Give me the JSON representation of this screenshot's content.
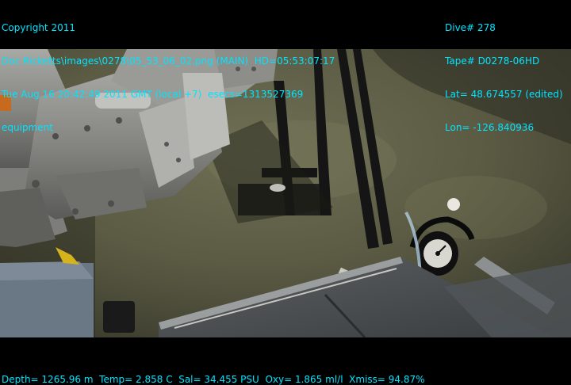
{
  "overlay": {
    "color": "#00e5ff",
    "top_left": [
      "Copyright 2011",
      "Doc Ricketts\\images\\0278\\05_53_06_02.png (MAIN)  HD=05:53:07:17",
      "Tue Aug 16 20:42:49 2011 GMT (local +7)  esecs=1313527369",
      "equipment"
    ],
    "top_right": [
      "Dive# 278",
      "Tape# D0278-06HD",
      "Lat= 48.674557 (edited)",
      "Lon= -126.840936"
    ],
    "bottom": "Depth= 1265.96 m  Temp= 2.858 C  Sal= 34.455 PSU  Oxy= 1.865 ml/l  Xmiss= 94.87%"
  }
}
